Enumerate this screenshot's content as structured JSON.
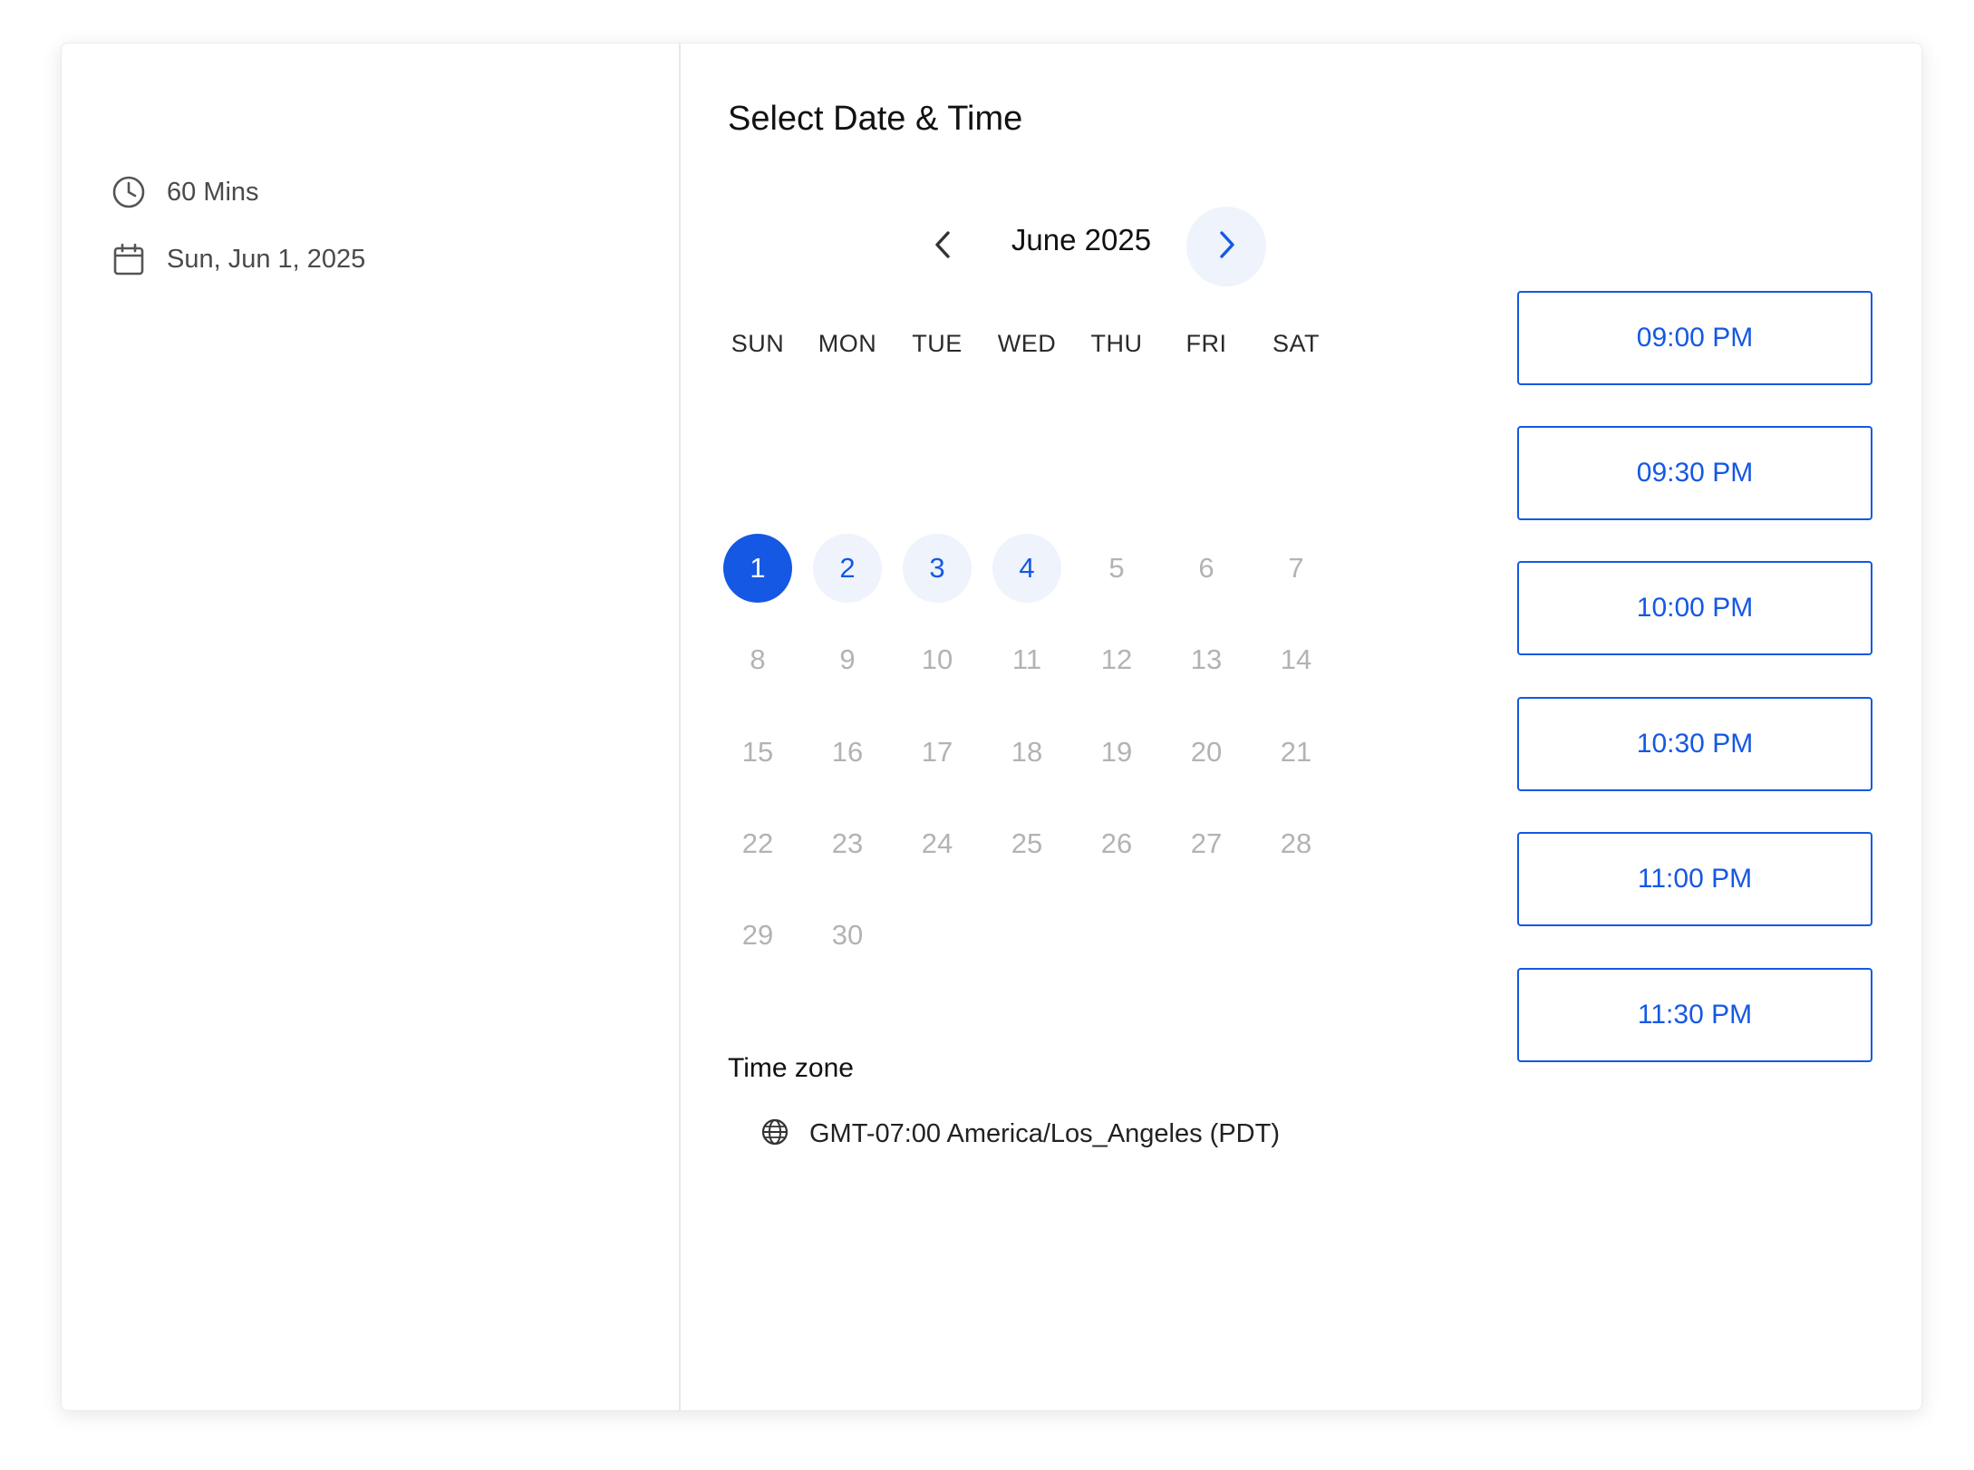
{
  "event": {
    "duration": "60 Mins",
    "date": "Sun, Jun 1, 2025"
  },
  "scheduler": {
    "title": "Select Date & Time",
    "month_label": "June 2025",
    "weekdays": [
      "SUN",
      "MON",
      "TUE",
      "WED",
      "THU",
      "FRI",
      "SAT"
    ],
    "days": [
      "1",
      "2",
      "3",
      "4",
      "5",
      "6",
      "7",
      "8",
      "9",
      "10",
      "11",
      "12",
      "13",
      "14",
      "15",
      "16",
      "17",
      "18",
      "19",
      "20",
      "21",
      "22",
      "23",
      "24",
      "25",
      "26",
      "27",
      "28",
      "29",
      "30"
    ],
    "selected_day": "1",
    "available_days": [
      "2",
      "3",
      "4"
    ]
  },
  "timezone": {
    "label": "Time zone",
    "value": "GMT-07:00 America/Los_Angeles (PDT)"
  },
  "slots": [
    "09:00 PM",
    "09:30 PM",
    "10:00 PM",
    "10:30 PM",
    "11:00 PM",
    "11:30 PM"
  ],
  "colors": {
    "accent": "#1558e3",
    "accent_light": "#eef3fc",
    "disabled_day": "#b3b3b3"
  },
  "icons": {
    "duration": "clock-icon",
    "date": "calendar-icon",
    "prev": "chevron-left-icon",
    "next": "chevron-right-icon",
    "timezone": "globe-icon",
    "dropdown": "caret-down-icon"
  }
}
